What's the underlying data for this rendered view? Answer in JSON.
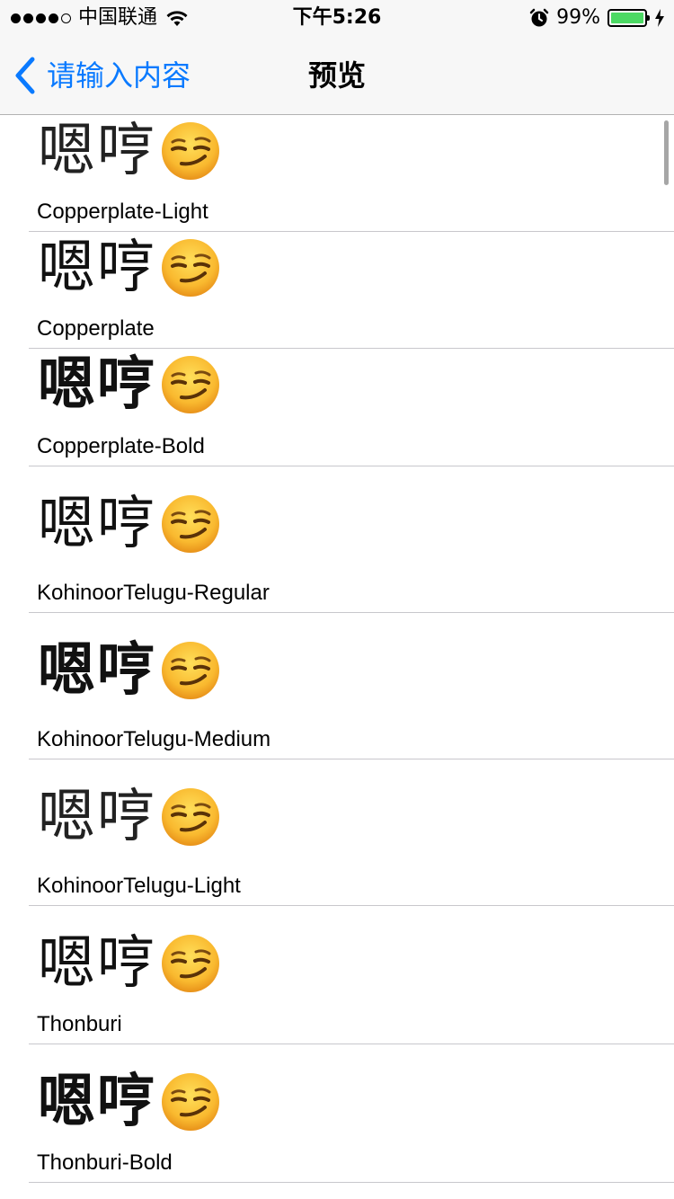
{
  "status_bar": {
    "signal_dots": 5,
    "signal_filled": 4,
    "carrier": "中国联通",
    "time": "下午5:26",
    "battery_percent": "99%",
    "battery_level": 0.99,
    "battery_color": "#4cd964",
    "icons": [
      "signal-dots",
      "wifi-icon",
      "alarm-icon",
      "battery-icon",
      "charging-bolt-icon"
    ]
  },
  "nav": {
    "back_label": "请输入内容",
    "title": "预览",
    "accent": "#0a7aff"
  },
  "sample_text": "嗯哼",
  "sample_emoji": "smirking-face-emoji",
  "fonts": [
    {
      "name": "Copperplate-Light",
      "weight": "light"
    },
    {
      "name": "Copperplate",
      "weight": "regular"
    },
    {
      "name": "Copperplate-Bold",
      "weight": "bold"
    },
    {
      "name": "KohinoorTelugu-Regular",
      "weight": "regular"
    },
    {
      "name": "KohinoorTelugu-Medium",
      "weight": "bold"
    },
    {
      "name": "KohinoorTelugu-Light",
      "weight": "light"
    },
    {
      "name": "Thonburi",
      "weight": "regular"
    },
    {
      "name": "Thonburi-Bold",
      "weight": "bold"
    }
  ]
}
